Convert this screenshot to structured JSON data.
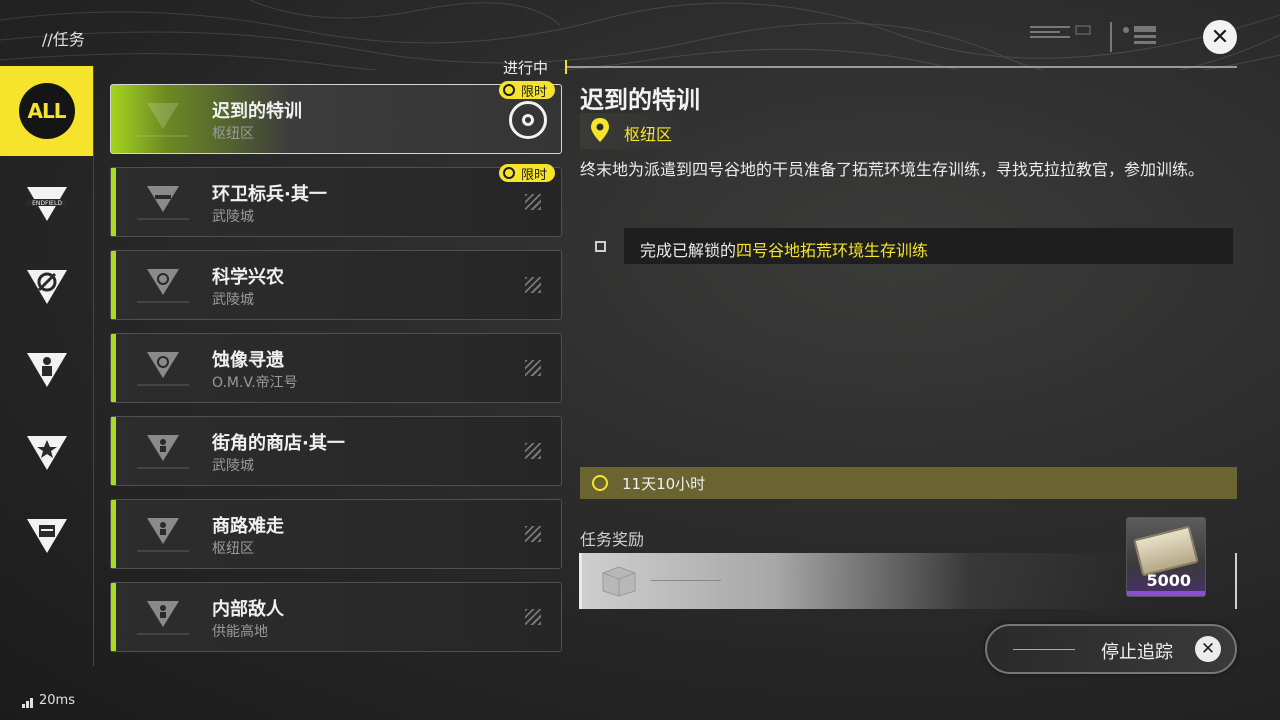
{
  "header": {
    "breadcrumb": "//任务",
    "status_label": "进行中",
    "close_icon": "close-icon"
  },
  "sidebar": {
    "items": [
      {
        "label": "ALL",
        "icon": "all-icon",
        "active": true
      },
      {
        "label": "ENDFIELD",
        "icon": "endfield-icon"
      },
      {
        "label": "",
        "icon": "compass-triangle-icon"
      },
      {
        "label": "",
        "icon": "person-triangle-icon"
      },
      {
        "label": "",
        "icon": "star-triangle-icon"
      },
      {
        "label": "",
        "icon": "calendar-triangle-icon"
      }
    ]
  },
  "quests": [
    {
      "title": "迟到的特训",
      "region": "枢纽区",
      "selected": true,
      "limited": true,
      "limited_label": "限时",
      "tracked": true
    },
    {
      "title": "环卫标兵·其一",
      "region": "武陵城",
      "limited": true,
      "limited_label": "限时"
    },
    {
      "title": "科学兴农",
      "region": "武陵城"
    },
    {
      "title": "蚀像寻遗",
      "region": "O.M.V.帝江号"
    },
    {
      "title": "街角的商店·其一",
      "region": "武陵城"
    },
    {
      "title": "商路难走",
      "region": "枢纽区"
    },
    {
      "title": "内部敌人",
      "region": "供能高地"
    }
  ],
  "detail": {
    "title": "迟到的特训",
    "location": "枢纽区",
    "description": "终末地为派遣到四号谷地的干员准备了拓荒环境生存训练，寻找克拉拉教官，参加训练。",
    "objective_prefix": "完成已解锁的",
    "objective_highlight": "四号谷地拓荒环境生存训练",
    "time_left": "11天10小时",
    "reward_label": "任务奖励",
    "reward_item": {
      "icon": "cash-stack-icon",
      "count": "5000"
    },
    "stop_tracking_label": "停止追踪"
  },
  "network": {
    "ping": "20ms"
  },
  "colors": {
    "accent_yellow": "#f5e42b",
    "accent_green": "#a9dc1f",
    "rarity_purple": "#8a4fd6"
  }
}
